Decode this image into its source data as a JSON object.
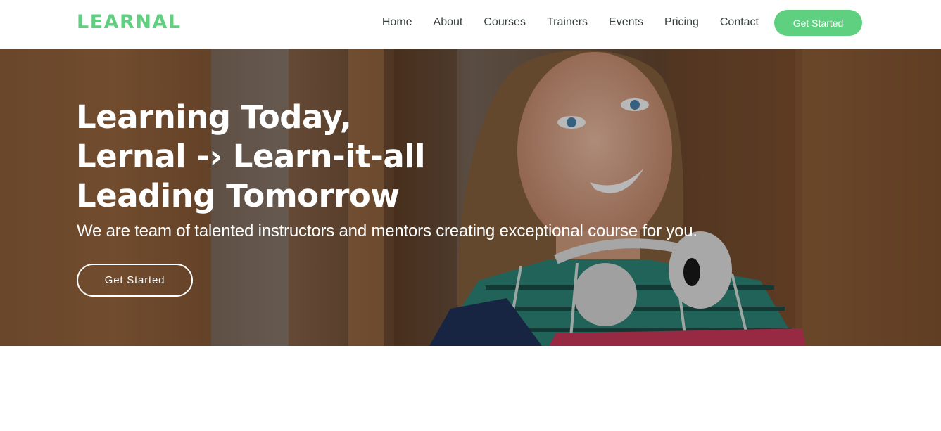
{
  "header": {
    "logo": "LEARNAL",
    "nav": [
      "Home",
      "About",
      "Courses",
      "Trainers",
      "Events",
      "Pricing",
      "Contact"
    ],
    "cta_label": "Get Started"
  },
  "hero": {
    "title_lines": [
      "Learning Today,",
      "Lernal -› Learn-it-all",
      "Leading Tomorrow"
    ],
    "subtitle": "We are team of talented instructors and mentors creating exceptional course for you.",
    "cta_label": "Get Started"
  },
  "colors": {
    "accent": "#5fcf80",
    "nav_text": "#37423b",
    "hero_text": "#ffffff"
  }
}
